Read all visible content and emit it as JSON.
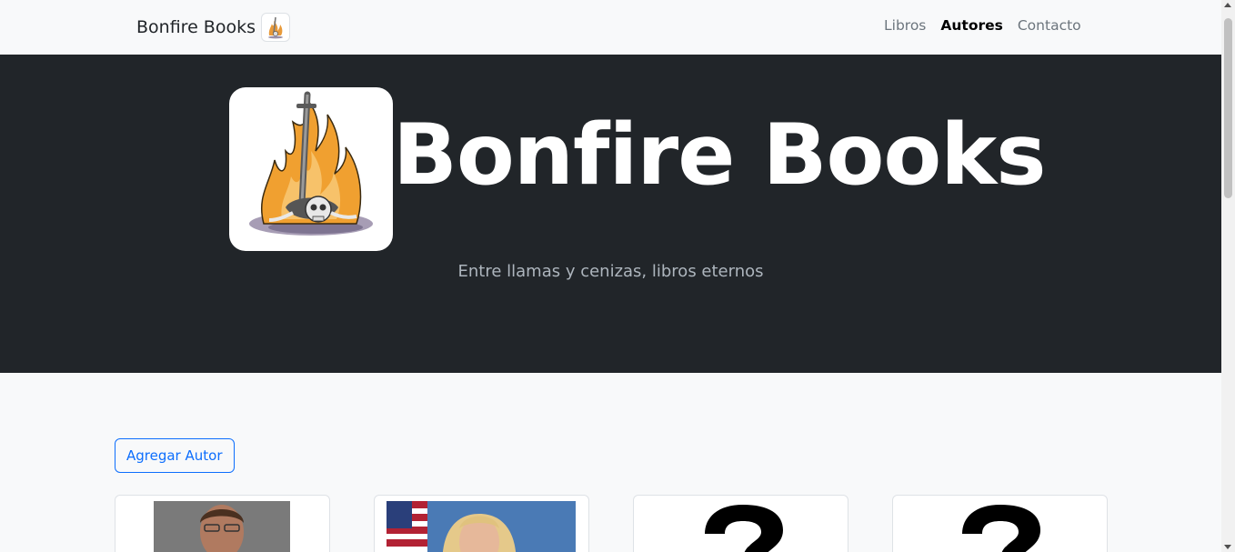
{
  "navbar": {
    "brand": "Bonfire Books",
    "brand_icon": "bonfire-logo-icon",
    "links": [
      {
        "label": "Libros",
        "active": false
      },
      {
        "label": "Autores",
        "active": true
      },
      {
        "label": "Contacto",
        "active": false
      }
    ]
  },
  "hero": {
    "title": "Bonfire Books",
    "subtitle": "Entre llamas y cenizas, libros eternos",
    "logo_icon": "bonfire-logo-icon"
  },
  "main": {
    "add_button": "Agregar Autor",
    "authors": [
      {
        "photo": "author-photo-man"
      },
      {
        "photo": "author-photo-woman-flag"
      },
      {
        "photo": "placeholder-question-icon"
      },
      {
        "photo": "placeholder-question-icon"
      }
    ]
  },
  "colors": {
    "navbar_bg": "#f8f9fa",
    "hero_bg": "#212529",
    "accent": "#0d6efd",
    "flame": "#f0a030"
  }
}
